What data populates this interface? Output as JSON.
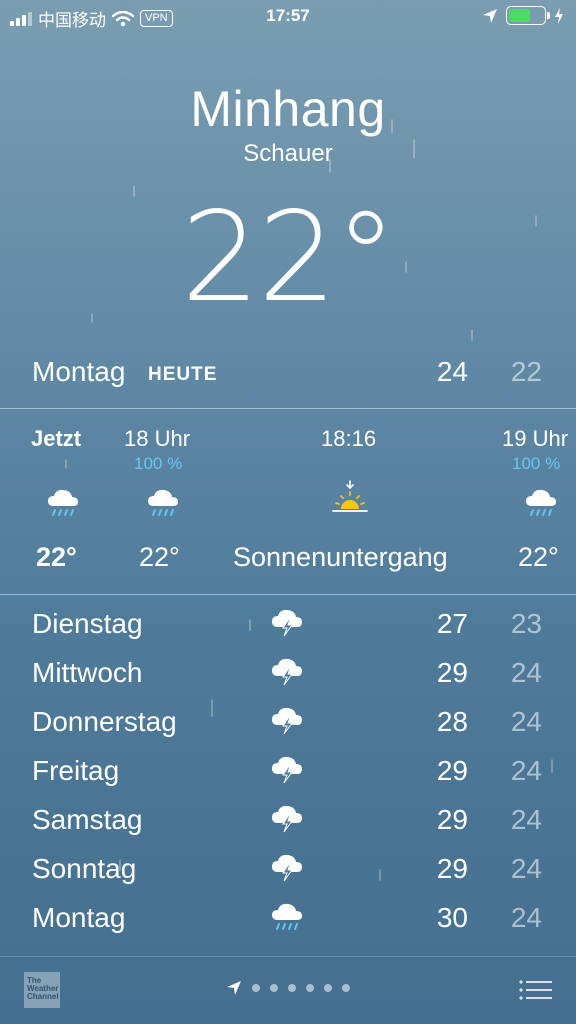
{
  "status_bar": {
    "carrier": "中国移动",
    "vpn": "VPN",
    "time": "17:57"
  },
  "location": {
    "city": "Minhang",
    "condition": "Schauer",
    "temperature": "22°"
  },
  "today": {
    "day": "Montag",
    "tag": "HEUTE",
    "high": "24",
    "low": "22"
  },
  "hourly": [
    {
      "label": "Jetzt",
      "pct": "",
      "icon": "rain-cloud-icon",
      "temp": "22°"
    },
    {
      "label": "18 Uhr",
      "pct": "100 %",
      "icon": "rain-cloud-icon",
      "temp": "22°"
    },
    {
      "label": "18:16",
      "pct": "",
      "icon": "sunset-icon",
      "temp": "Sonnenuntergang"
    },
    {
      "label": "19 Uhr",
      "pct": "100 %",
      "icon": "rain-cloud-icon",
      "temp": "22°"
    }
  ],
  "daily": [
    {
      "day": "Dienstag",
      "icon": "thunderstorm-icon",
      "high": "27",
      "low": "23"
    },
    {
      "day": "Mittwoch",
      "icon": "thunderstorm-icon",
      "high": "29",
      "low": "24"
    },
    {
      "day": "Donnerstag",
      "icon": "thunderstorm-icon",
      "high": "28",
      "low": "24"
    },
    {
      "day": "Freitag",
      "icon": "thunderstorm-icon",
      "high": "29",
      "low": "24"
    },
    {
      "day": "Samstag",
      "icon": "thunderstorm-icon",
      "high": "29",
      "low": "24"
    },
    {
      "day": "Sonntag",
      "icon": "thunderstorm-icon",
      "high": "29",
      "low": "24"
    },
    {
      "day": "Montag",
      "icon": "rain-cloud-icon",
      "high": "30",
      "low": "24"
    }
  ],
  "bottom_bar": {
    "logo_text": "The Weather Channel",
    "page_count": 6
  },
  "colors": {
    "accent_blue": "#66c6f2",
    "sun_yellow": "#f5c518",
    "battery_green": "#4cd964"
  }
}
